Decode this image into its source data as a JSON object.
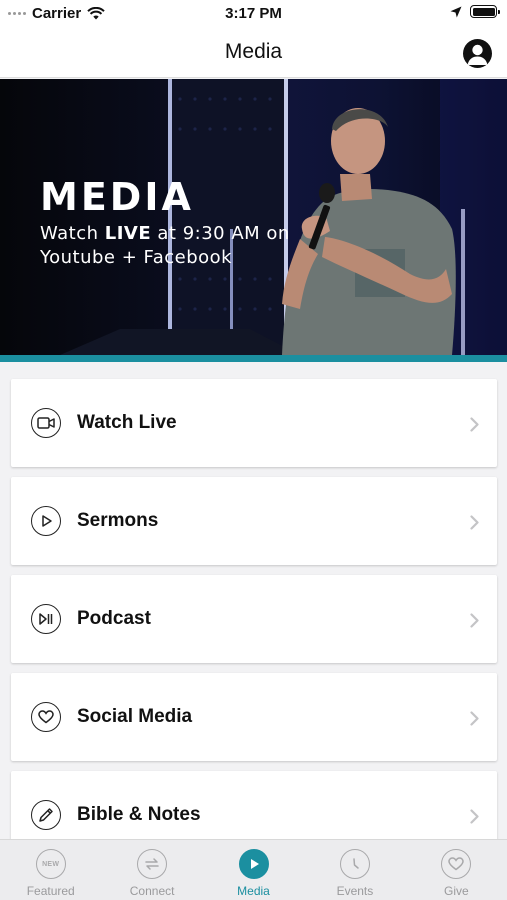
{
  "status_bar": {
    "carrier": "Carrier",
    "time": "3:17 PM"
  },
  "nav": {
    "title": "Media"
  },
  "hero": {
    "title": "MEDIA",
    "line1_prefix": "Watch ",
    "line1_bold": "LIVE",
    "line1_suffix": " at 9:30 AM on",
    "line2": "Youtube + Facebook"
  },
  "menu": {
    "items": [
      {
        "label": "Watch Live",
        "icon": "video-camera-icon"
      },
      {
        "label": "Sermons",
        "icon": "play-icon"
      },
      {
        "label": "Podcast",
        "icon": "play-pause-icon"
      },
      {
        "label": "Social Media",
        "icon": "heart-icon"
      },
      {
        "label": "Bible & Notes",
        "icon": "pencil-icon"
      }
    ]
  },
  "tabs": [
    {
      "label": "Featured",
      "icon": "new-badge-icon",
      "badge_text": "NEW"
    },
    {
      "label": "Connect",
      "icon": "swap-arrows-icon"
    },
    {
      "label": "Media",
      "icon": "play-icon",
      "active": true
    },
    {
      "label": "Events",
      "icon": "clock-icon"
    },
    {
      "label": "Give",
      "icon": "heart-icon"
    }
  ],
  "colors": {
    "accent": "#1b8fa0",
    "tab_inactive": "#9a9a9c"
  }
}
